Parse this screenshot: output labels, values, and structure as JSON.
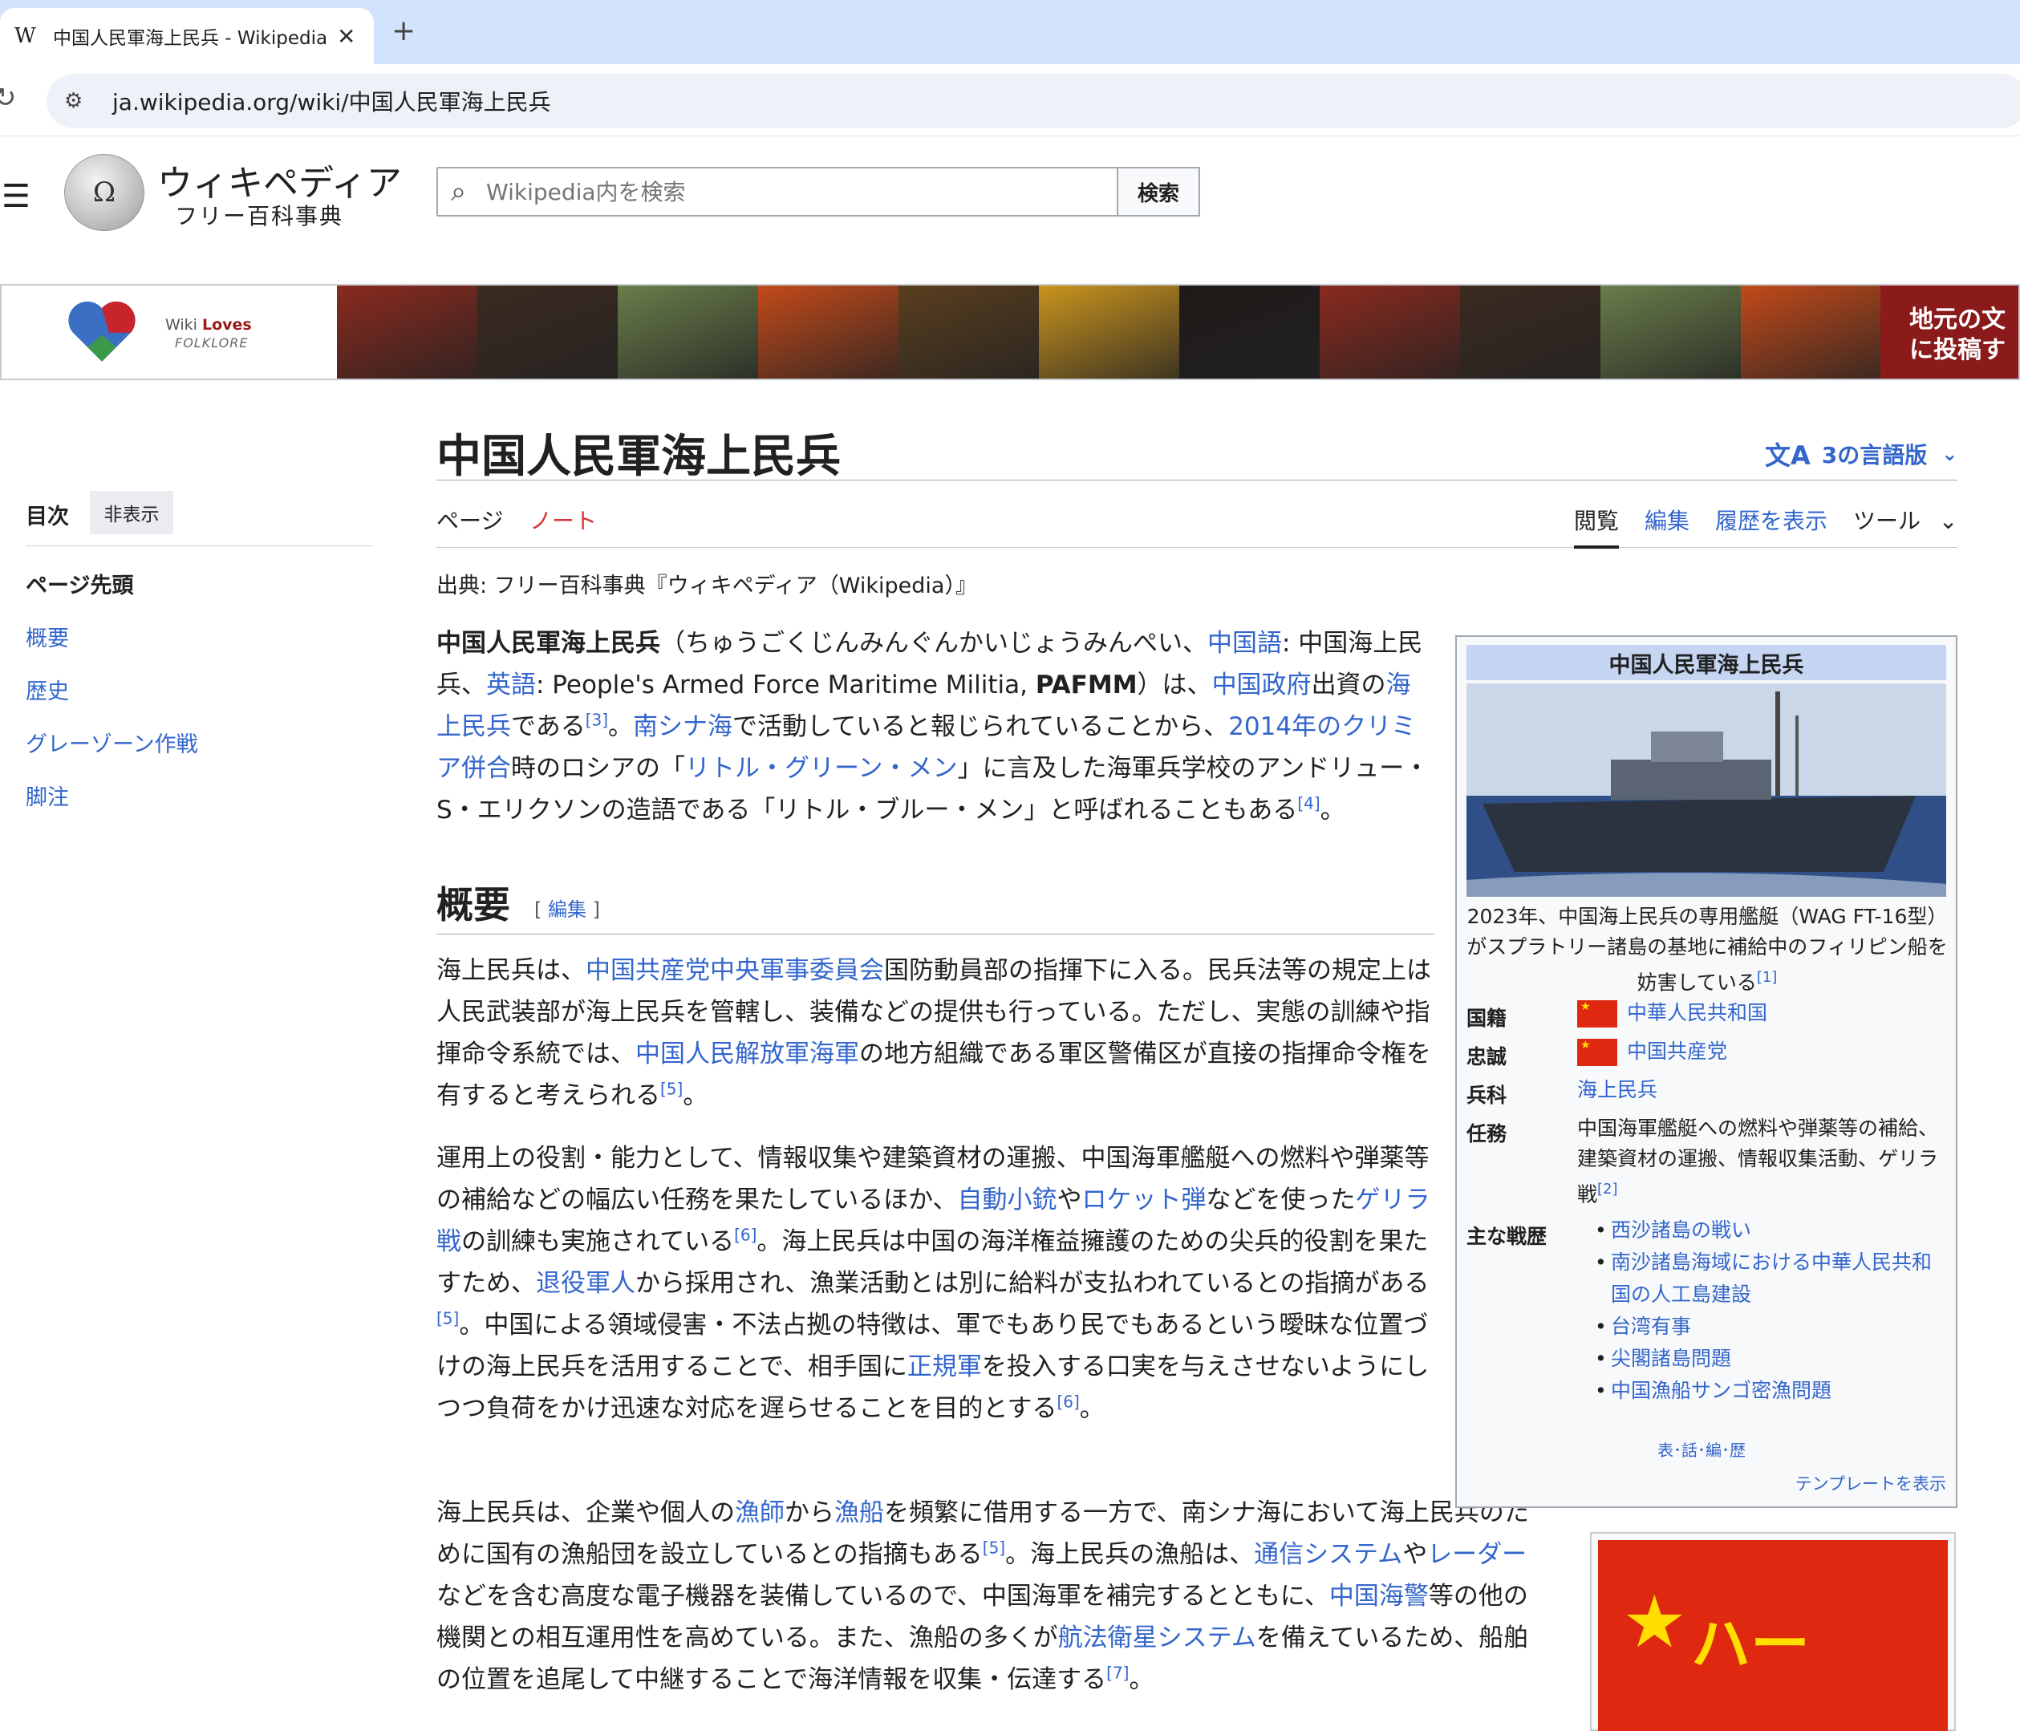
{
  "browser": {
    "tab_title": "中国人民軍海上民兵 - Wikipedia",
    "tab_favicon": "W",
    "url": "ja.wikipedia.org/wiki/中国人民軍海上民兵"
  },
  "header": {
    "logo_word": "ウィキペディア",
    "logo_tagline": "フリー百科事典",
    "search_placeholder": "Wikipedia内を検索",
    "search_button": "検索"
  },
  "banner": {
    "wiki": "Wiki ",
    "loves": "Loves",
    "folklore": "FOLKLORE",
    "cta_line1": "地元の文",
    "cta_line2": "に投稿す",
    "photo_colors": [
      "#8a2a1e",
      "#3b2a20",
      "#6a7d4a",
      "#c24a1a",
      "#5a3e1e",
      "#c9941e",
      "#1e1a18",
      "#8a2a1e",
      "#3b2a20",
      "#6a7d4a",
      "#c24a1a"
    ]
  },
  "toc": {
    "title": "目次",
    "hide": "非表示",
    "top": "ページ先頭",
    "items": [
      "概要",
      "歴史",
      "グレーゾーン作戦",
      "脚注"
    ]
  },
  "article": {
    "title": "中国人民軍海上民兵",
    "languages": "3の言語版",
    "tab_page": "ページ",
    "tab_talk": "ノート",
    "tab_read": "閲覧",
    "tab_edit": "編集",
    "tab_history": "履歴を表示",
    "tab_tools": "ツール",
    "from": "出典: フリー百科事典『ウィキペディア（Wikipedia）』",
    "section_heading": "概要",
    "section_edit": "編集"
  },
  "infobox": {
    "title": "中国人民軍海上民兵",
    "caption": "2023年、中国海上民兵の専用艦艇（WAG FT-16型）がスプラトリー諸島の基地に補給中のフィリピン船を妨害している",
    "caption_ref": "[1]",
    "country_label": "国籍",
    "country_value": "中華人民共和国",
    "allegiance_label": "忠誠",
    "allegiance_value": "中国共産党",
    "branch_label": "兵科",
    "branch_value": "海上民兵",
    "mission_label": "任務",
    "mission_value": "中国海軍艦艇への燃料や弾薬等の補給、建築資材の運搬、情報収集活動、ゲリラ戦",
    "mission_ref": "[2]",
    "battles_label": "主な戦歴",
    "battles": [
      "西沙諸島の戦い",
      "南沙諸島海域における中華人民共和国の人工島建設",
      "台湾有事",
      "尖閣諸島問題",
      "中国漁船サンゴ密漁問題"
    ],
    "nav": "表･話･編･歴",
    "template_link": "テンプレートを表示"
  }
}
